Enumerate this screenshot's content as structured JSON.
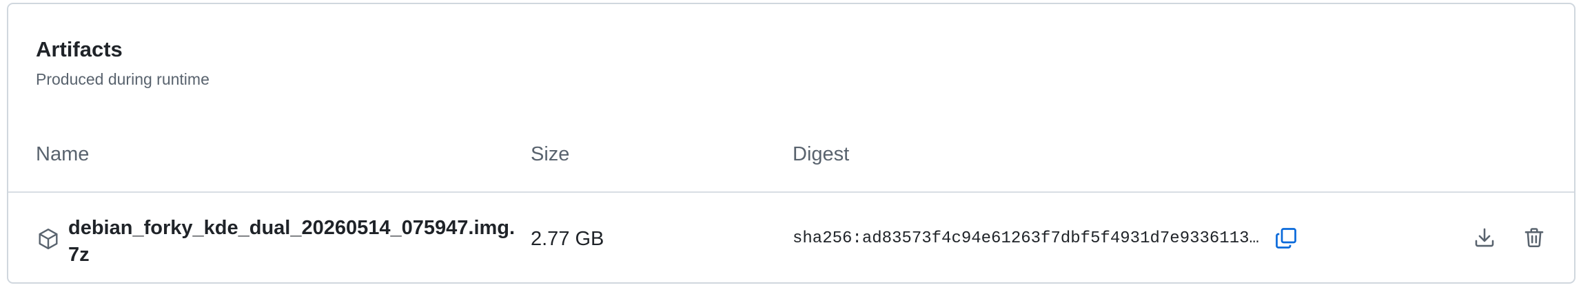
{
  "artifacts": {
    "title": "Artifacts",
    "subtitle": "Produced during runtime",
    "columns": {
      "name": "Name",
      "size": "Size",
      "digest": "Digest"
    },
    "rows": [
      {
        "name": "debian_forky_kde_dual_20260514_075947.img.7z",
        "size": "2.77 GB",
        "digest": "sha256:ad83573f4c94e61263f7dbf5f4931d7e9336113…",
        "icons": [
          "package-icon",
          "copy-icon",
          "download-icon",
          "trash-icon"
        ]
      }
    ]
  },
  "colors": {
    "accent": "#0969da",
    "muted_text": "#59636e",
    "border": "#d0d7de"
  }
}
